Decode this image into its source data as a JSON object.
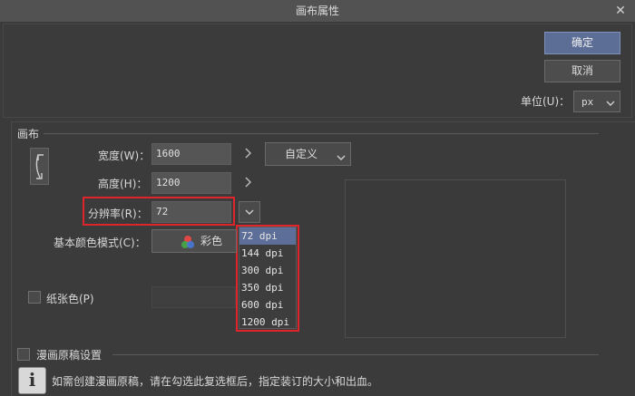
{
  "window": {
    "title": "画布属性",
    "close_label": "✕"
  },
  "buttons": {
    "ok": "确定",
    "cancel": "取消"
  },
  "unit": {
    "label": "单位(U)：",
    "value": "px"
  },
  "canvas_section": {
    "title": "画布"
  },
  "width": {
    "label": "宽度(W)：",
    "value": "1600"
  },
  "height": {
    "label": "高度(H)：",
    "value": "1200"
  },
  "preset": {
    "value": "自定义"
  },
  "resolution": {
    "label": "分辨率(R)：",
    "value": "72",
    "options": [
      "72 dpi",
      "144 dpi",
      "300 dpi",
      "350 dpi",
      "600 dpi",
      "1200 dpi"
    ],
    "selected_index": 0
  },
  "color_mode": {
    "label": "基本颜色模式(C)：",
    "value": "彩色"
  },
  "paper_color": {
    "label": "纸张色(P)"
  },
  "manga_section": {
    "label": "漫画原稿设置"
  },
  "info": {
    "text": "如需创建漫画原稿，请在勾选此复选框后，指定装订的大小和出血。"
  },
  "colors": {
    "highlight": "#e0242b",
    "accent": "#5c6e96"
  }
}
